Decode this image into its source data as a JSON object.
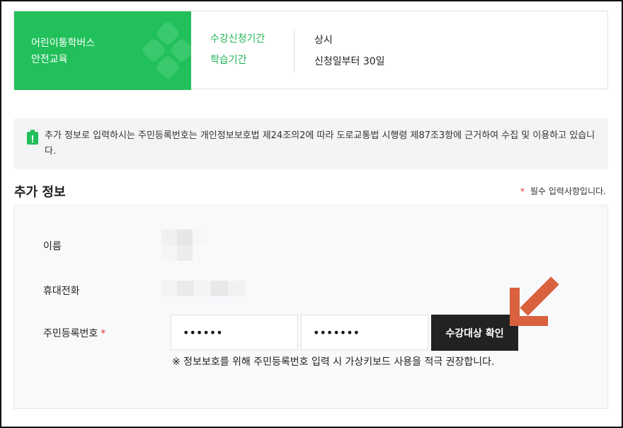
{
  "course": {
    "title_line1": "어린이통학버스",
    "title_line2": "안전교육",
    "labels": [
      "수강신청기간",
      "학습기간"
    ],
    "values": [
      "상시",
      "신청일부터 30일"
    ]
  },
  "notice": {
    "icon": "id-badge-icon",
    "text": "추가 정보로 입력하시는 주민등록번호는 개인정보보호법 제24조의2에 따라 도로교통법 시행령 제87조3항에 근거하여 수집 및 이용하고 있습니다."
  },
  "section": {
    "title": "추가 정보",
    "required_star": "*",
    "required_note": "필수 입력사항입니다."
  },
  "form": {
    "name_label": "이름",
    "phone_label": "휴대전화",
    "rrn_label": "주민등록번호",
    "rrn_required": "*",
    "rrn_front_value": "••••••",
    "rrn_back_value": "•••••••",
    "confirm_label": "수강대상 확인",
    "hint": "※ 정보보호를 위해 주민등록번호 입력 시 가상키보드 사용을 적극 권장합니다."
  },
  "colors": {
    "brand_green": "#22c05b",
    "accent_green_text": "#22b455",
    "required_red": "#e5322d",
    "arrow_orange": "#d9613e"
  }
}
